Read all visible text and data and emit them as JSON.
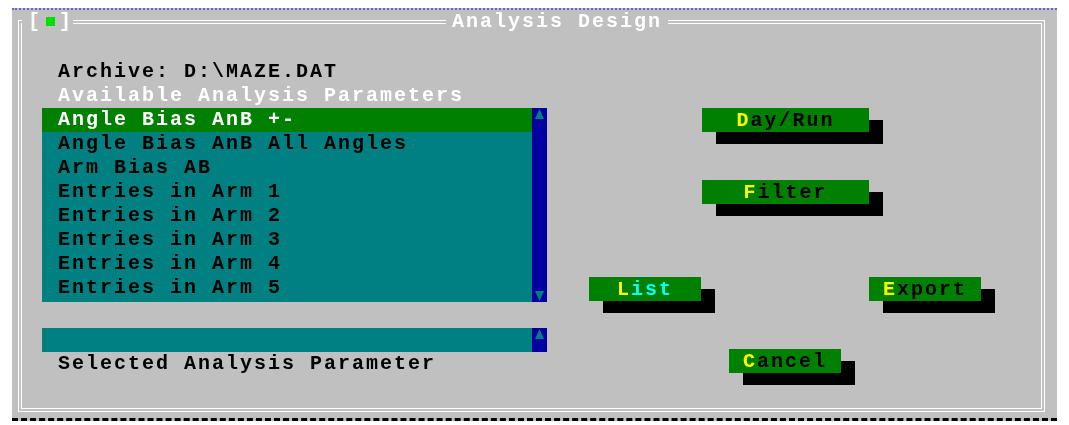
{
  "window": {
    "title": "Analysis Design",
    "close_button": {
      "open": "[",
      "close": "]"
    }
  },
  "archive": "Archive: D:\\MAZE.DAT",
  "list_heading": "Available Analysis Parameters",
  "parameters": [
    {
      "label": "Angle Bias AnB +-",
      "selected": true
    },
    {
      "label": "Angle Bias AnB All Angles",
      "selected": false
    },
    {
      "label": "Arm Bias AB",
      "selected": false
    },
    {
      "label": "Entries in Arm 1",
      "selected": false
    },
    {
      "label": "Entries in Arm 2",
      "selected": false
    },
    {
      "label": "Entries in Arm 3",
      "selected": false
    },
    {
      "label": "Entries in Arm 4",
      "selected": false
    },
    {
      "label": "Entries in Arm 5",
      "selected": false
    }
  ],
  "selected_field_label": "Selected Analysis Parameter",
  "buttons": [
    {
      "key": "D",
      "rest": "ay/Run",
      "focused": false
    },
    {
      "key": "F",
      "rest": "ilter",
      "focused": false
    },
    {
      "key": "L",
      "rest": "ist",
      "focused": true
    },
    {
      "key": "E",
      "rest": "xport",
      "focused": false
    },
    {
      "key": "C",
      "rest": "ancel",
      "focused": false
    }
  ]
}
